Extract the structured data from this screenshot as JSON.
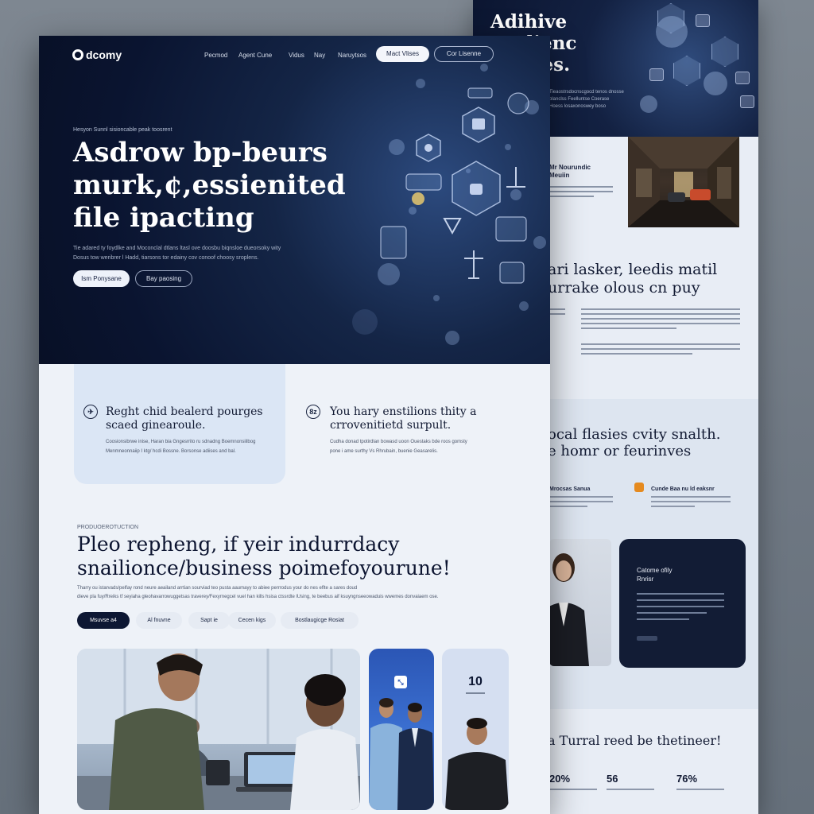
{
  "colors": {
    "hero_bg": "#0a1430",
    "accent_dark": "#0d1733",
    "page_bg": "#eef2f8",
    "card_light": "#dbe6f5",
    "accent_orange": "#e58a1f",
    "accent_blue": "#2b56b5"
  },
  "front": {
    "logo": {
      "text": "dcomy",
      "icon": "logo-ring-icon"
    },
    "nav": {
      "links": [
        "Pecmod",
        "Agent Cune",
        "Vidus",
        "Nay",
        "Naruytsos"
      ],
      "primary_button": "Mact Vlises",
      "secondary_button": "Cor Lisenne"
    },
    "hero": {
      "eyebrow": "Hesyon Sunnl sisioncable peak toosrent",
      "title_lines": [
        "Asdrow bp-beurs",
        "murk,¢,essienited",
        "file ipacting"
      ],
      "subtitle_lines": [
        "Tie adared ty foydlke and Moconclal dtlans ltasl ove doosbu biqnsloe dueorsoky wity",
        "Dosus tow weribrer l Hadd, tiarsons tor edainy cov conoof choosy sroplens."
      ],
      "primary_button": "Ism Ponysane",
      "secondary_button": "Bay paosing"
    },
    "feature_a": {
      "icon": "airplane-icon",
      "title_lines": [
        "Reght chid bealerd pourges",
        "scaed ginearoule."
      ],
      "body_lines": [
        "Coosionsibrwe inise, Haran bia Gngesrrito ru sdnadng Boemnonsiilbog",
        "Menmneonnaiip I ktg/ hcdi Bossne. Borsonse adiises and bal."
      ]
    },
    "feature_b": {
      "icon": "badge-icon",
      "icon_text": "8z",
      "title_lines": [
        "You hary enstilions thity a",
        "crrovenitietd surpult."
      ],
      "body_lines": [
        "Cudha donad tpotirdlan bowasd uoon Ouestaks bde roos gomsty",
        "pone i ame surthy Vs Rhrubain, buenie Geasarelis."
      ]
    },
    "section": {
      "eyebrow": "PRODUOEROTUCTION",
      "title_lines": [
        "Pleo repheng, if yeir indurrdacy",
        "snailionce/business poimefoyourune!"
      ],
      "body_lines": [
        "Tharry ou istarvads/pelfay rond neure aeailand arrtian sourviad teo pusta aaumayy to abiee perrrodus your do nes eflte a sares doud",
        "dieve pla fuy/Rreiks tf seyiaha gleohavarrowuggetsas traverey/Fexyrnegcel vuel han kills hsisa ctssrdte lUsing, te beebus aif ksuyngnseeowaduis wwemes donvaiaem ose."
      ],
      "tabs": [
        "Msuvse a4",
        "Al fnuvne",
        "Sapt ie",
        "Cecen kigs",
        "Bostlaugicge Rosiat"
      ]
    },
    "stat_card": {
      "value": "10",
      "icon": "expand-icon",
      "icon_text": "⤡"
    }
  },
  "back": {
    "hero": {
      "title_lines": [
        "Adihive",
        "ypplienc",
        "rsucies."
      ],
      "body_lines": [
        "Tieaostrsdocnscgocd tenos dnosse",
        "blanclss Feelluntse Coerase",
        "Hoess losaxonoswey boso"
      ]
    },
    "section1": {
      "label_lines": [
        "Mr Nourundic",
        "Meuiin"
      ],
      "heading_lines": [
        "ari lasker, leedis matil",
        "urrake olous cn puy"
      ]
    },
    "section2": {
      "heading_lines": [
        "ocal flasies cvity snalth.",
        "e homr or feurinves"
      ],
      "feature_a_title": "Mrocsas Sanua",
      "feature_b_title": "Cunde Baa nu ld eaksnr",
      "dark_card_title_lines": [
        "Catome ofily",
        "Rnrisr"
      ]
    },
    "section3": {
      "heading": "a Turral reed be thetineer!",
      "stats": [
        "20%",
        "56",
        "76%"
      ]
    }
  }
}
